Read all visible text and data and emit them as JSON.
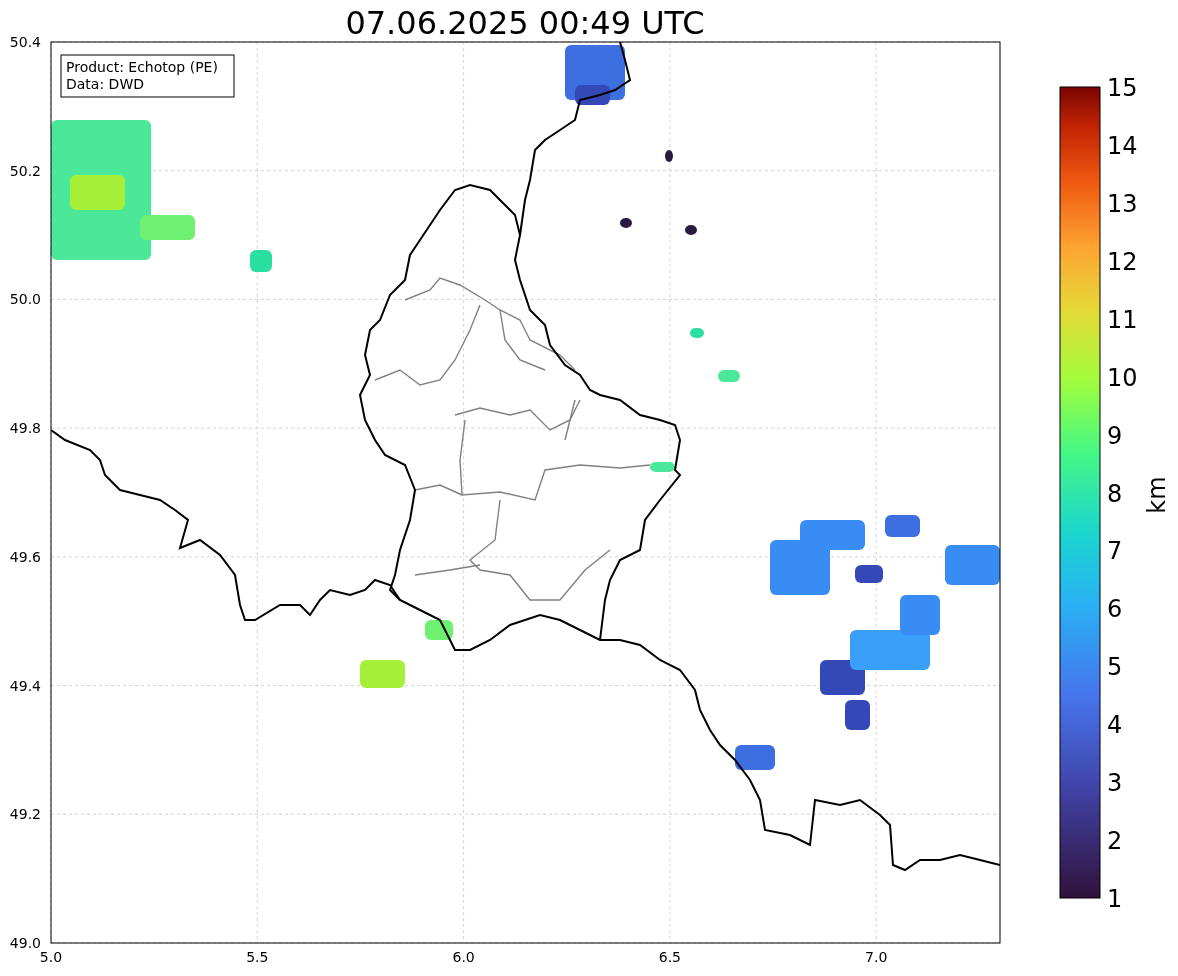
{
  "title": "07.06.2025 00:49 UTC",
  "info_box": [
    "Product: Echotop (PE)",
    "Data: DWD"
  ],
  "map": {
    "x_tick_labels": [
      "5.0",
      "5.5",
      "6.0",
      "6.5",
      "7.0"
    ],
    "y_tick_labels": [
      "50.4",
      "50.2",
      "50.0",
      "49.8",
      "49.6",
      "49.4",
      "49.2",
      "49.0"
    ]
  },
  "colorbar": {
    "label": "km",
    "tick_labels": [
      "15",
      "14",
      "13",
      "12",
      "11",
      "10",
      "9",
      "8",
      "7",
      "6",
      "5",
      "4",
      "3",
      "2",
      "1"
    ]
  }
}
